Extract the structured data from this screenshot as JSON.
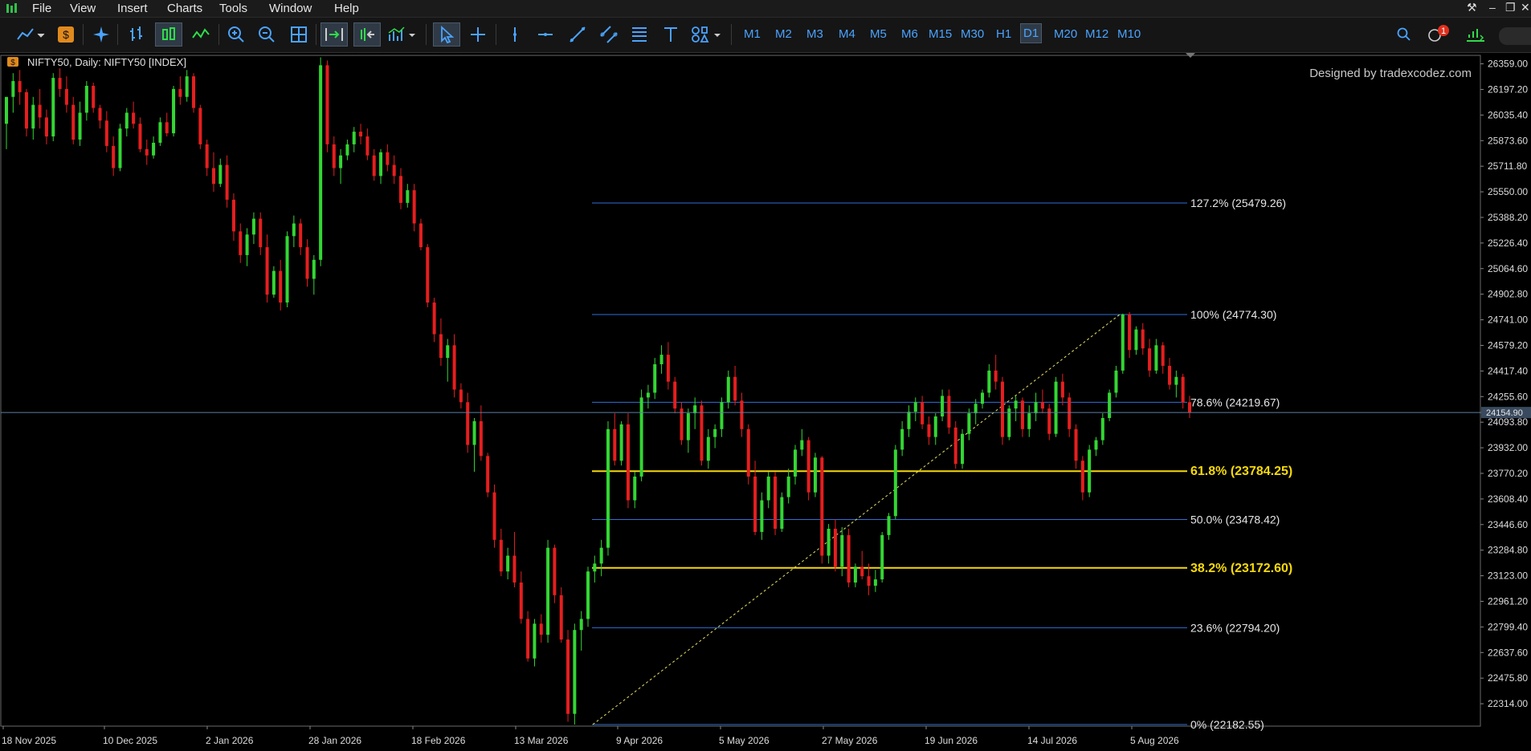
{
  "menu": {
    "items": [
      "File",
      "View",
      "Insert",
      "Charts",
      "Tools",
      "Window",
      "Help"
    ]
  },
  "toolbar": {
    "timeframes": [
      "M1",
      "M2",
      "M3",
      "M4",
      "M5",
      "M6",
      "M15",
      "M30",
      "H1",
      "D1",
      "M20",
      "M12",
      "M10"
    ],
    "active_timeframe": "D1",
    "notification_count": "1",
    "icons": [
      "line-chart-icon",
      "dollar-icon",
      "magic-icon",
      "bar-chart-icon",
      "candlestick-icon",
      "line-icon",
      "zoom-in-icon",
      "zoom-out-icon",
      "grid-icon",
      "autoscroll-icon",
      "chart-shift-icon",
      "indicators-icon",
      "cursor-icon",
      "crosshair-icon",
      "vertical-line-icon",
      "horizontal-line-icon",
      "trend-line-icon",
      "channel-icon",
      "fibonacci-icon",
      "text-icon",
      "shapes-icon",
      "search-icon",
      "bell-icon",
      "signal-icon"
    ]
  },
  "chart": {
    "header": "NIFTY50, Daily:  NIFTY50 [INDEX]",
    "credit": "Designed by tradexcodez.com",
    "current_price": "24154.90"
  },
  "chart_data": {
    "type": "candlestick",
    "y_ticks": [
      "26359.00",
      "26197.20",
      "26035.40",
      "25873.60",
      "25711.80",
      "25550.00",
      "25388.20",
      "25226.40",
      "25064.60",
      "24902.80",
      "24741.00",
      "24579.20",
      "24417.40",
      "24255.60",
      "24093.80",
      "23932.00",
      "23770.20",
      "23608.40",
      "23446.60",
      "23284.80",
      "23123.00",
      "22961.20",
      "22799.40",
      "22637.60",
      "22475.80",
      "22314.00"
    ],
    "x_ticks": [
      "18 Nov 2025",
      "10 Dec 2025",
      "2 Jan 2026",
      "28 Jan 2026",
      "18 Feb 2026",
      "13 Mar 2026",
      "9 Apr 2026",
      "5 May 2026",
      "27 May 2026",
      "19 Jun 2026",
      "14 Jul 2026",
      "5 Aug 2026"
    ],
    "ylim": [
      22180,
      26400
    ],
    "fib_levels": [
      {
        "label": "127.2% (25479.26)",
        "value": 25479.26,
        "color": "#2e6fd8",
        "bold": false
      },
      {
        "label": "100% (24774.30)",
        "value": 24774.3,
        "color": "#2e6fd8",
        "bold": false
      },
      {
        "label": "78.6% (24219.67)",
        "value": 24219.67,
        "color": "#2e6fd8",
        "bold": false
      },
      {
        "label": "61.8% (23784.25)",
        "value": 23784.25,
        "color": "#f5d90a",
        "bold": true
      },
      {
        "label": "50.0% (23478.42)",
        "value": 23478.42,
        "color": "#2e6fd8",
        "bold": false
      },
      {
        "label": "38.2% (23172.60)",
        "value": 23172.6,
        "color": "#f5d90a",
        "bold": true
      },
      {
        "label": "23.6% (22794.20)",
        "value": 22794.2,
        "color": "#2e6fd8",
        "bold": false
      },
      {
        "label": "0% (22182.55)",
        "value": 22182.55,
        "color": "#2e6fd8",
        "bold": false
      }
    ],
    "colors": {
      "up": "#33d633",
      "down": "#e61e1e",
      "price_line": "#5b7ea6",
      "label_box": "#3a4a5e"
    }
  }
}
